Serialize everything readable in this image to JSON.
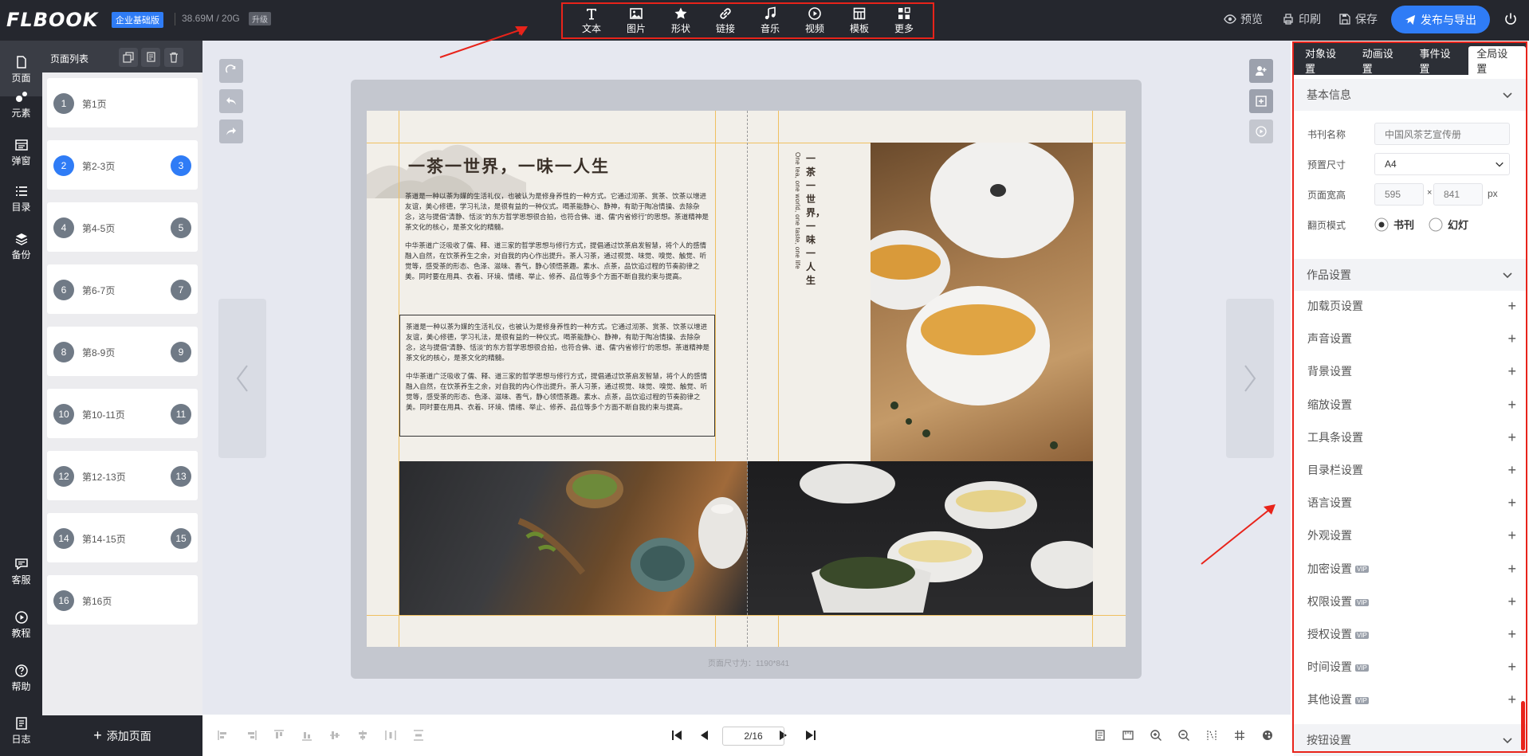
{
  "header": {
    "logo": "FLBOOK",
    "edition": "企业基础版",
    "storage": "38.69M / 20G",
    "upgrade": "升级",
    "tools": [
      {
        "icon": "text-icon",
        "label": "文本"
      },
      {
        "icon": "image-icon",
        "label": "图片"
      },
      {
        "icon": "star-shape-icon",
        "label": "形状"
      },
      {
        "icon": "link-icon",
        "label": "链接"
      },
      {
        "icon": "music-icon",
        "label": "音乐"
      },
      {
        "icon": "video-icon",
        "label": "视频"
      },
      {
        "icon": "template-icon",
        "label": "模板"
      },
      {
        "icon": "more-icon",
        "label": "更多"
      }
    ],
    "preview": "预览",
    "print": "印刷",
    "save": "保存",
    "publish": "发布与导出"
  },
  "leftnav": [
    {
      "icon": "page-icon",
      "label": "页面"
    },
    {
      "icon": "elements-icon",
      "label": "元素"
    },
    {
      "icon": "popup-icon",
      "label": "弹窗"
    },
    {
      "icon": "toc-icon",
      "label": "目录"
    },
    {
      "icon": "backup-icon",
      "label": "备份"
    },
    {
      "icon": "service-icon",
      "label": "客服"
    },
    {
      "icon": "tutorial-icon",
      "label": "教程"
    },
    {
      "icon": "help-icon",
      "label": "帮助"
    },
    {
      "icon": "log-icon",
      "label": "日志"
    }
  ],
  "pagelist": {
    "title": "页面列表",
    "add": "添加页面",
    "items": [
      {
        "left": "1",
        "label": "第1页",
        "right": ""
      },
      {
        "left": "2",
        "label": "第2-3页",
        "right": "3"
      },
      {
        "left": "4",
        "label": "第4-5页",
        "right": "5"
      },
      {
        "left": "6",
        "label": "第6-7页",
        "right": "7"
      },
      {
        "left": "8",
        "label": "第8-9页",
        "right": "9"
      },
      {
        "left": "10",
        "label": "第10-11页",
        "right": "11"
      },
      {
        "left": "12",
        "label": "第12-13页",
        "right": "13"
      },
      {
        "left": "14",
        "label": "第14-15页",
        "right": "15"
      },
      {
        "left": "16",
        "label": "第16页",
        "right": ""
      }
    ]
  },
  "book": {
    "title": "一茶一世界，一味一人生",
    "para1": "茶道是一种以茶为媒的生活礼仪，也被认为是修身养性的一种方式。它通过沏茶、赏茶、饮茶以增进友谊，美心修德，学习礼法，是很有益的一种仪式。喝茶能静心、静神，有助于陶冶情操、去除杂念，这与提倡“清静、恬淡”的东方哲学思想很合拍，也符合佛、道、儒“内省修行”的思想。茶道精神是茶文化的核心，是茶文化的精髓。",
    "para2": "中华茶道广泛吸收了儒、释、道三家的哲学思想与修行方式，提倡通过饮茶启发智慧，将个人的感情融入自然，在饮茶养生之余，对自我的内心作出提升。茶人习茶，通过视觉、味觉、嗅觉、触觉、听觉等，感受茶的形态、色泽、滋味、香气，静心领悟茶趣。素水、点茶，品饮追过程的节奏韵律之美。同时要在用具、衣着、环境、情绪、举止、修养、品位等多个方面不断自我约束与提高。",
    "para3": "茶道是一种以茶为媒的生活礼仪，也被认为是修身养性的一种方式。它通过沏茶、赏茶、饮茶以增进友谊，美心修德，学习礼法，是很有益的一种仪式。喝茶能静心、静神，有助于陶冶情操、去除杂念，这与提倡“清静、恬淡”的东方哲学思想很合拍，也符合佛、道、儒“内省修行”的思想。茶道精神是茶文化的核心，是茶文化的精髓。",
    "para4": "中华茶道广泛吸收了儒、释、道三家的哲学思想与修行方式，提倡通过饮茶启发智慧，将个人的感情融入自然，在饮茶养生之余，对自我的内心作出提升。茶人习茶，通过视觉、味觉、嗅觉、触觉、听觉等，感受茶的形态、色泽、滋味、香气，静心领悟茶趣。素水、点茶，品饮追过程的节奏韵律之美。同时要在用具、衣着、环境、情绪、举止、修养、品位等多个方面不断自我约束与提高。",
    "vertical_cn": "一茶一世界，一味一人生",
    "vertical_en": "One tea, one world, one taste, one life",
    "page_size": "页面尺寸为：1190*841"
  },
  "pager": {
    "value": "2/16"
  },
  "panel": {
    "tabs": [
      "对象设置",
      "动画设置",
      "事件设置",
      "全局设置"
    ],
    "basic": "基本信息",
    "name_label": "书刊名称",
    "name_value": "中国风茶艺宣传册",
    "size_label": "预置尺寸",
    "size_value": "A4",
    "wh_label": "页面宽高",
    "width": "595",
    "times": "×",
    "height": "841",
    "unit": "px",
    "flip_label": "翻页模式",
    "flip_book": "书刊",
    "flip_slide": "幻灯",
    "work": "作品设置",
    "rows": [
      {
        "label": "加载页设置",
        "vip": false
      },
      {
        "label": "声音设置",
        "vip": false
      },
      {
        "label": "背景设置",
        "vip": false
      },
      {
        "label": "缩放设置",
        "vip": false
      },
      {
        "label": "工具条设置",
        "vip": false
      },
      {
        "label": "目录栏设置",
        "vip": false
      },
      {
        "label": "语言设置",
        "vip": false
      },
      {
        "label": "外观设置",
        "vip": false
      },
      {
        "label": "加密设置",
        "vip": true
      },
      {
        "label": "权限设置",
        "vip": true
      },
      {
        "label": "授权设置",
        "vip": true
      },
      {
        "label": "时间设置",
        "vip": true
      },
      {
        "label": "其他设置",
        "vip": true
      }
    ],
    "vip_badge": "VIP",
    "buttons": "按钮设置"
  },
  "colors": {
    "accent": "#2f7cf6",
    "highlight": "#e8231a",
    "dark": "#25272e"
  }
}
